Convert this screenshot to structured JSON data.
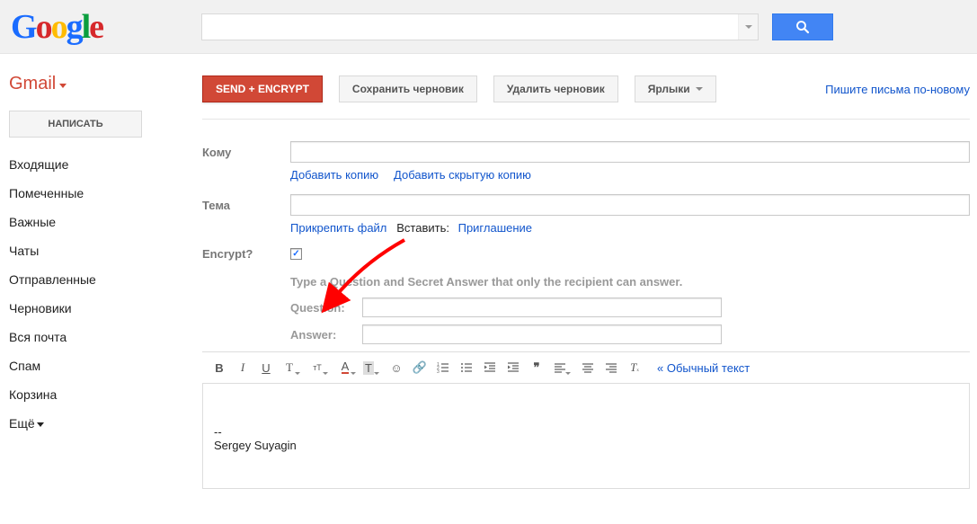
{
  "logo": {
    "g1": "G",
    "g2": "o",
    "g3": "o",
    "g4": "g",
    "g5": "l",
    "g6": "e"
  },
  "app_label": "Gmail",
  "compose_label": "НАПИСАТЬ",
  "nav": {
    "items": [
      "Входящие",
      "Помеченные",
      "Важные",
      "Чаты",
      "Отправленные",
      "Черновики",
      "Вся почта",
      "Спам",
      "Корзина"
    ],
    "more_label": "Ещё"
  },
  "actions": {
    "send_encrypt": "SEND + ENCRYPT",
    "save_draft": "Сохранить черновик",
    "delete_draft": "Удалить черновик",
    "labels": "Ярлыки",
    "promo": "Пишите письма по-новому"
  },
  "compose": {
    "to_label": "Кому",
    "add_cc": "Добавить копию",
    "add_bcc": "Добавить скрытую копию",
    "subject_label": "Тема",
    "attach": "Прикрепить файл",
    "insert_lead": "Вставить:",
    "invitation": "Приглашение",
    "encrypt_label": "Encrypt?",
    "encrypt_hint": "Type a Question and Secret Answer that only the recipient can answer.",
    "question_label": "Question:",
    "answer_label": "Answer:",
    "plain_text": "« Обычный текст",
    "signature_sep": "--",
    "signature": "Sergey Suyagin"
  }
}
